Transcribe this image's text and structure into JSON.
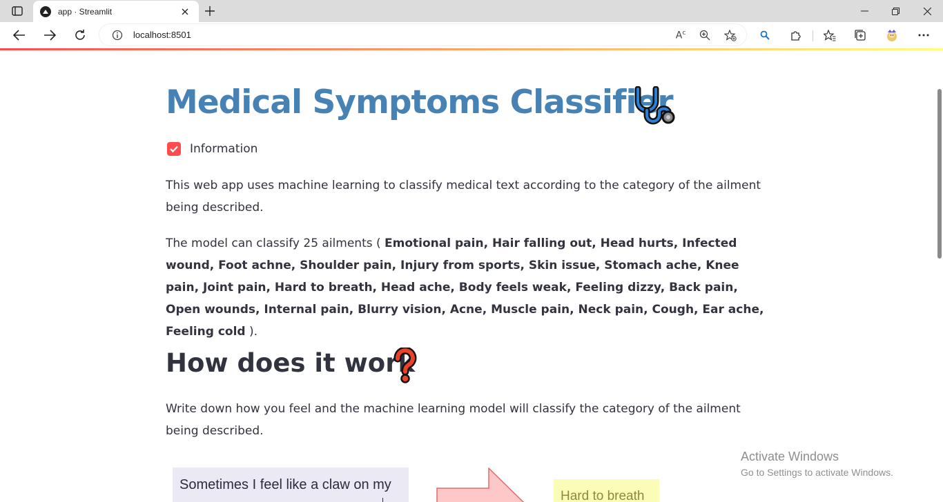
{
  "browser": {
    "tab_title": "app · Streamlit",
    "url": "localhost:8501"
  },
  "app": {
    "title": "Medical Symptoms Classifier",
    "checkbox": {
      "label": "Information",
      "checked": true
    },
    "intro": "This web app uses machine learning to classify medical text according to the category of the ailment being described.",
    "ailments_prefix": "The model can classify 25 ailments (",
    "ailments_list": "Emotional pain, Hair falling out, Head hurts, Infected wound, Foot achne, Shoulder pain, Injury from sports, Skin issue, Stomach ache, Knee pain, Joint pain, Hard to breath, Head ache, Body feels weak, Feeling dizzy, Back pain, Open wounds, Internal pain, Blurry vision, Acne, Muscle pain, Neck pain, Cough, Ear ache, Feeling cold",
    "ailments_suffix": ").",
    "how_heading": "How does it work",
    "how_text": "Write down how you feel and the machine learning model will classify the category of the ailment being described.",
    "illustration": {
      "input_text": "Sometimes I feel like a claw on my",
      "result_text": "Hard to breath"
    }
  },
  "watermark": {
    "title": "Activate Windows",
    "subtitle": "Go to Settings to activate Windows."
  },
  "colors": {
    "accent": "#ff4b4b",
    "title": "#4682b4",
    "text": "#31333f"
  }
}
